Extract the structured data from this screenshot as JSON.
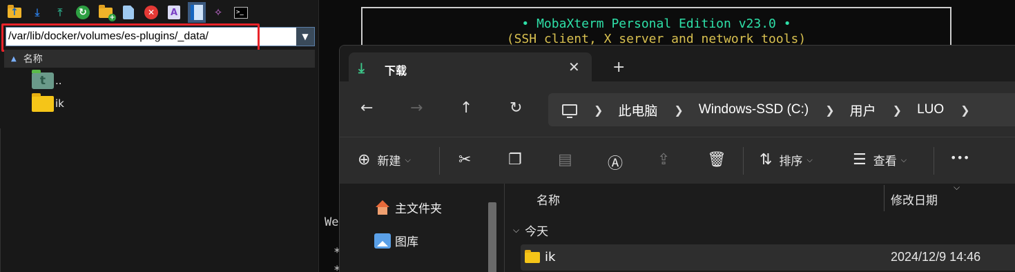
{
  "moba": {
    "toolbar_icons": [
      "folder-up-icon",
      "download-icon",
      "upload-icon",
      "refresh-icon",
      "new-folder-icon",
      "new-file-icon",
      "delete-icon",
      "rename-icon",
      "bookmark-icon",
      "magic-wand-icon",
      "terminal-icon"
    ],
    "path_value": "/var/lib/docker/volumes/es-plugins/_data/",
    "file_header": "名称",
    "files": [
      {
        "name": "..",
        "icon": "parent-folder-icon"
      },
      {
        "name": "ik",
        "icon": "folder-icon"
      }
    ],
    "highlight_color": "#e8232a"
  },
  "terminal": {
    "banner_line1": "• MobaXterm Personal Edition v23.0 •",
    "banner_line2": "(SSH client, X server and network tools)",
    "text_we": "We",
    "text_star1": "*",
    "text_star2": "*"
  },
  "explorer": {
    "tab_title": "下载",
    "tab_close": "✕",
    "tab_new": "+",
    "breadcrumbs": [
      "此电脑",
      "Windows-SSD (C:)",
      "用户",
      "LUO"
    ],
    "commands": {
      "new_label": "新建",
      "sort_label": "排序",
      "view_label": "查看",
      "more_label": "•••"
    },
    "nav_items": [
      {
        "label": "主文件夹",
        "icon": "home-icon"
      },
      {
        "label": "图库",
        "icon": "gallery-icon"
      }
    ],
    "columns": {
      "name": "名称",
      "date": "修改日期"
    },
    "group": "今天",
    "rows": [
      {
        "name": "ik",
        "date": "2024/12/9 14:46"
      }
    ],
    "accent": "#3cc88a"
  }
}
